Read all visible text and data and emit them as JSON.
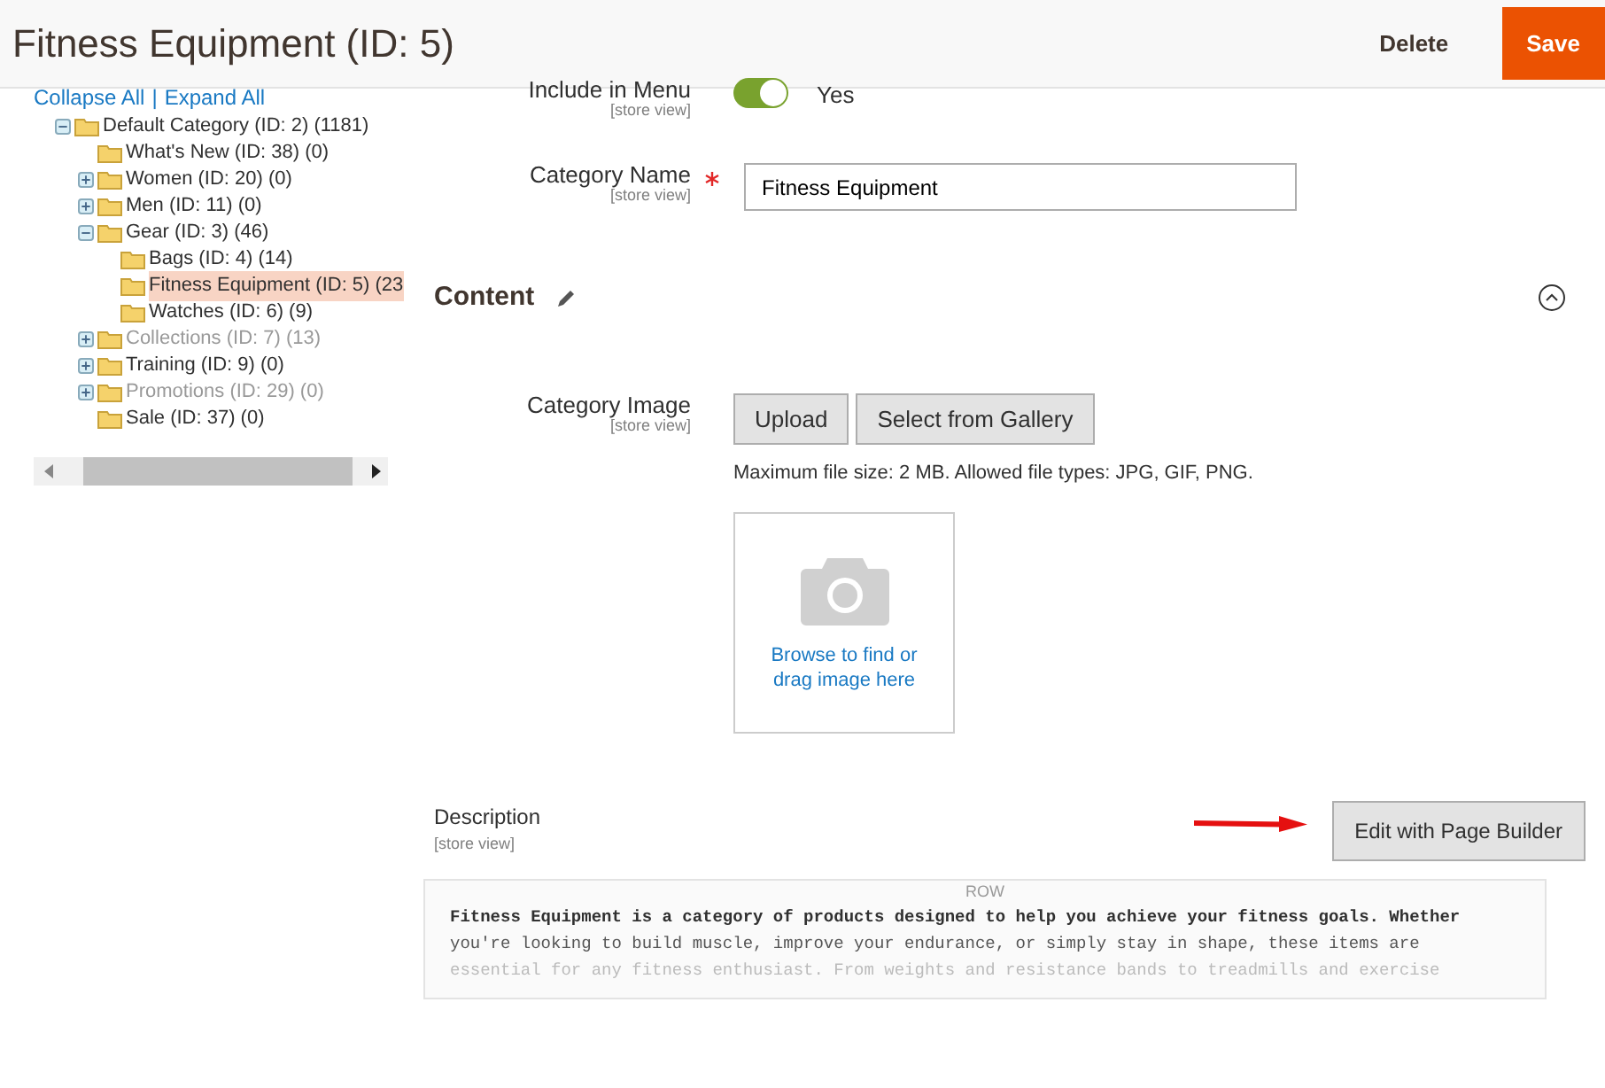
{
  "header": {
    "title": "Fitness Equipment (ID: 5)",
    "buttons": [
      {
        "label": "Delete",
        "kind": "link"
      },
      {
        "label": "Save",
        "kind": "primary"
      }
    ]
  },
  "tree": {
    "links": [
      "Collapse All",
      "Expand All"
    ],
    "separator": "|",
    "items": [
      {
        "label": "Default Category (ID: 2) (1181)",
        "expandable": true,
        "expanded": true,
        "selected": false,
        "disabled": false,
        "children": [
          {
            "label": "What's New (ID: 38) (0)",
            "selected": false,
            "disabled": false
          },
          {
            "label": "Women (ID: 20) (0)",
            "expandable": true,
            "expanded": false,
            "selected": false,
            "disabled": false
          },
          {
            "label": "Men (ID: 11) (0)",
            "expandable": true,
            "expanded": false,
            "selected": false,
            "disabled": false
          },
          {
            "label": "Gear (ID: 3) (46)",
            "expandable": true,
            "expanded": true,
            "selected": false,
            "disabled": false,
            "children": [
              {
                "label": "Bags (ID: 4) (14)",
                "selected": false,
                "disabled": false
              },
              {
                "label": "Fitness Equipment (ID: 5) (23",
                "selected": true,
                "disabled": false
              },
              {
                "label": "Watches (ID: 6) (9)",
                "selected": false,
                "disabled": false
              }
            ]
          },
          {
            "label": "Collections (ID: 7) (13)",
            "expandable": true,
            "expanded": false,
            "selected": false,
            "disabled": true
          },
          {
            "label": "Training (ID: 9) (0)",
            "expandable": true,
            "expanded": false,
            "selected": false,
            "disabled": false
          },
          {
            "label": "Promotions (ID: 29) (0)",
            "expandable": true,
            "expanded": false,
            "selected": false,
            "disabled": true
          },
          {
            "label": "Sale (ID: 37) (0)",
            "selected": false,
            "disabled": false
          }
        ]
      }
    ]
  },
  "form": {
    "include_in_menu": {
      "label": "Include in Menu",
      "scope": "[store view]",
      "on": true,
      "value": "Yes"
    },
    "category_name": {
      "label": "Category Name",
      "scope": "[store view]",
      "required": true,
      "value": "Fitness Equipment"
    }
  },
  "content": {
    "title": "Content",
    "expanded": true,
    "category_image": {
      "label": "Category Image",
      "scope": "[store view]",
      "buttons": [
        "Upload",
        "Select from Gallery"
      ],
      "note": "Maximum file size: 2 MB. Allowed file types: JPG, GIF, PNG.",
      "drop_text": "Browse to find or drag image here"
    },
    "description": {
      "label": "Description",
      "scope": "[store view]",
      "button": "Edit with Page Builder",
      "row_label": "ROW",
      "lines": [
        "Fitness Equipment is a category of products designed to help you achieve your fitness goals. Whether",
        "you're looking to build muscle, improve your endurance, or simply stay in shape, these items are",
        "essential for any fitness enthusiast. From weights and resistance bands to treadmills and exercise"
      ]
    }
  }
}
